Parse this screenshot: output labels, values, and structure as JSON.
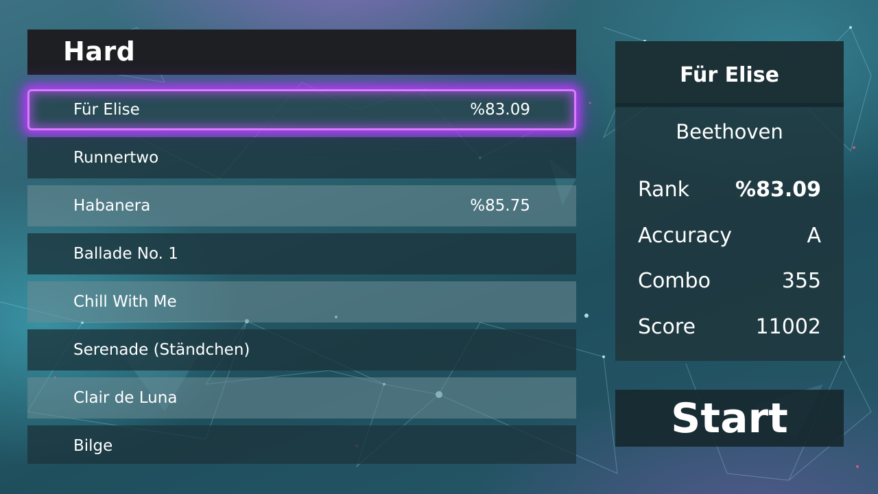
{
  "difficulty": "Hard",
  "songs": [
    {
      "name": "Für Elise",
      "percent": "%83.09",
      "selected": true
    },
    {
      "name": "Runnertwo",
      "percent": ""
    },
    {
      "name": "Habanera",
      "percent": "%85.75"
    },
    {
      "name": "Ballade No. 1",
      "percent": ""
    },
    {
      "name": "Chill With Me",
      "percent": ""
    },
    {
      "name": "Serenade (Ständchen)",
      "percent": ""
    },
    {
      "name": "Clair de Luna",
      "percent": ""
    },
    {
      "name": "Bilge",
      "percent": ""
    }
  ],
  "info": {
    "title": "Für Elise",
    "composer": "Beethoven",
    "stats": [
      {
        "label": "Rank",
        "value": "%83.09"
      },
      {
        "label": "Accuracy",
        "value": "A"
      },
      {
        "label": "Combo",
        "value": "355"
      },
      {
        "label": "Score",
        "value": "11002"
      }
    ]
  },
  "start_label": "Start",
  "colors": {
    "selection_glow": "#c050ff",
    "header_bg": "#1d1f22"
  }
}
